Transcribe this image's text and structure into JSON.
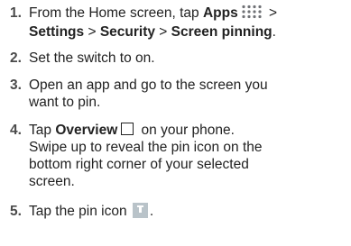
{
  "steps": [
    {
      "num": "1.",
      "l1_pre": "From the Home screen, tap ",
      "l1_apps": "Apps",
      "l1_post": " >",
      "l2_settings": "Settings",
      "l2_sep1": " > ",
      "l2_security": "Security",
      "l2_sep2": " > ",
      "l2_pinning": "Screen pinning",
      "l2_end": "."
    },
    {
      "num": "2.",
      "text": "Set the switch to on."
    },
    {
      "num": "3.",
      "l1": "Open an app and go to the screen you",
      "l2": "want to pin."
    },
    {
      "num": "4.",
      "l1_pre": "Tap ",
      "l1_bold": "Overview",
      "l1_post": " on your phone.",
      "l2": "Swipe up to reveal the pin icon on the",
      "l3": "bottom right corner of your selected",
      "l4": "screen."
    },
    {
      "num": "5.",
      "pre": "Tap the pin icon ",
      "post": "."
    }
  ],
  "icons": {
    "apps": "apps-grid-icon",
    "overview": "overview-icon",
    "pin": "pin-icon"
  }
}
